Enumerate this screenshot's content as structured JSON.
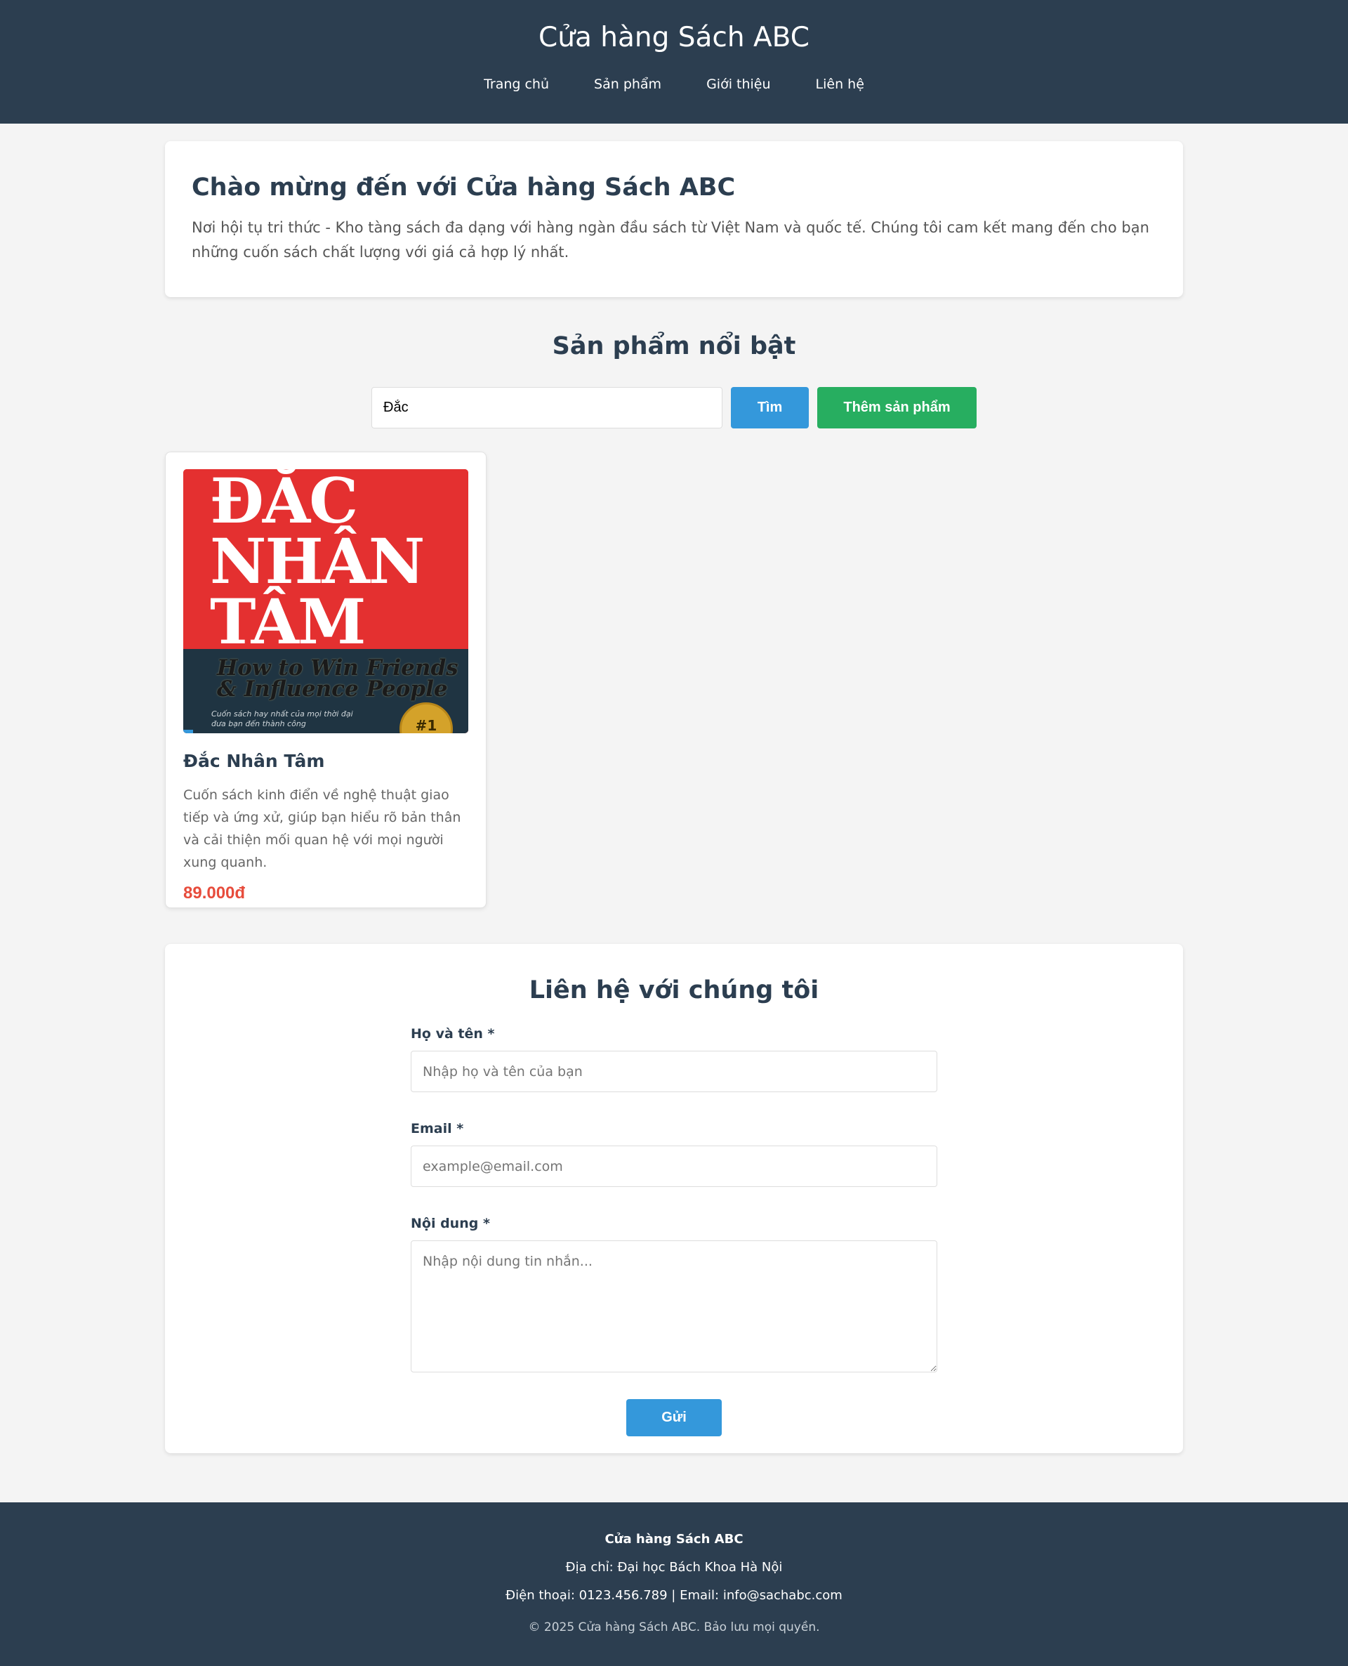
{
  "header": {
    "site_title": "Cửa hàng Sách ABC",
    "nav": [
      "Trang chủ",
      "Sản phẩm",
      "Giới thiệu",
      "Liên hệ"
    ]
  },
  "welcome": {
    "title": "Chào mừng đến với Cửa hàng Sách ABC",
    "text": "Nơi hội tụ tri thức - Kho tàng sách đa dạng với hàng ngàn đầu sách từ Việt Nam và quốc tế. Chúng tôi cam kết mang đến cho bạn những cuốn sách chất lượng với giá cả hợp lý nhất."
  },
  "products_section": {
    "title": "Sản phẩm nổi bật",
    "search_value": "Đắc",
    "search_button": "Tìm",
    "add_button": "Thêm sản phẩm",
    "items": [
      {
        "cover_title_lines": [
          "ĐẮC",
          "NHÂN",
          "TÂM"
        ],
        "cover_subtitle_lines": [
          "How to Win Friends",
          "& Influence People"
        ],
        "cover_tagline_lines": [
          "Cuốn sách hay nhất của mọi thời đại",
          "đưa bạn đến thành công"
        ],
        "cover_badge": "#1",
        "name": "Đắc Nhân Tâm",
        "description": "Cuốn sách kinh điển về nghệ thuật giao tiếp và ứng xử, giúp bạn hiểu rõ bản thân và cải thiện mối quan hệ với mọi người xung quanh.",
        "price": "89.000đ"
      }
    ]
  },
  "contact": {
    "title": "Liên hệ với chúng tôi",
    "name_label": "Họ và tên *",
    "name_placeholder": "Nhập họ và tên của bạn",
    "email_label": "Email *",
    "email_placeholder": "example@email.com",
    "message_label": "Nội dung *",
    "message_placeholder": "Nhập nội dung tin nhắn...",
    "submit_label": "Gửi"
  },
  "footer": {
    "name": "Cửa hàng Sách ABC",
    "address": "Địa chỉ: Đại học Bách Khoa Hà Nội",
    "contact": "Điện thoại: 0123.456.789 | Email: info@sachabc.com",
    "copyright": "© 2025 Cửa hàng Sách ABC. Bảo lưu mọi quyền."
  },
  "colors": {
    "header_bg": "#2c3e50",
    "primary": "#3498db",
    "success": "#27ae60",
    "price": "#e74c3c",
    "page_bg": "#f4f4f4"
  }
}
